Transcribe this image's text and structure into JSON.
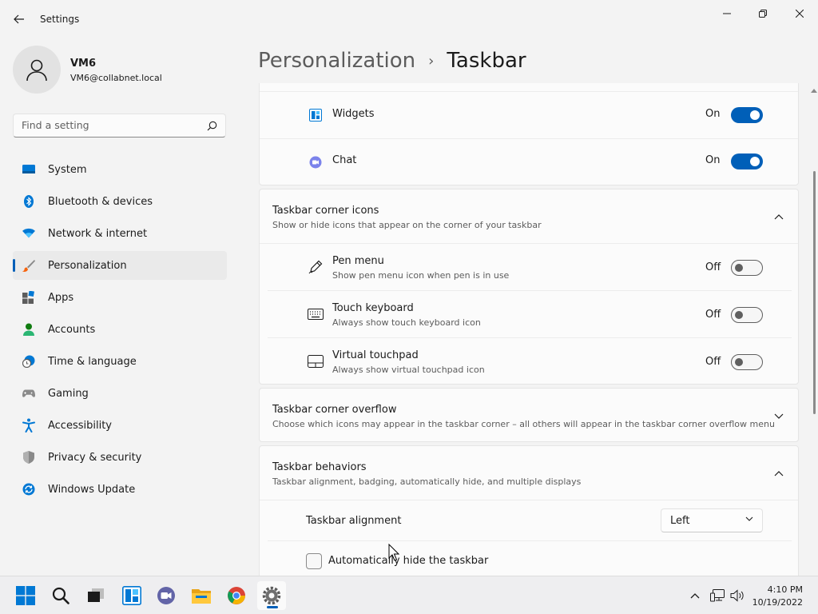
{
  "window": {
    "title": "Settings",
    "controls": [
      "minimize",
      "maximize",
      "close"
    ]
  },
  "profile": {
    "name": "VM6",
    "email": "VM6@collabnet.local"
  },
  "search": {
    "placeholder": "Find a setting"
  },
  "sidebar": {
    "items": [
      {
        "label": "System",
        "icon": "monitor-icon"
      },
      {
        "label": "Bluetooth & devices",
        "icon": "bluetooth-icon"
      },
      {
        "label": "Network & internet",
        "icon": "wifi-icon"
      },
      {
        "label": "Personalization",
        "icon": "paintbrush-icon",
        "active": true
      },
      {
        "label": "Apps",
        "icon": "apps-icon"
      },
      {
        "label": "Accounts",
        "icon": "person-icon"
      },
      {
        "label": "Time & language",
        "icon": "clock-globe-icon"
      },
      {
        "label": "Gaming",
        "icon": "gamepad-icon"
      },
      {
        "label": "Accessibility",
        "icon": "accessibility-icon"
      },
      {
        "label": "Privacy & security",
        "icon": "shield-icon"
      },
      {
        "label": "Windows Update",
        "icon": "update-icon"
      }
    ]
  },
  "breadcrumb": {
    "parent": "Personalization",
    "separator": "›",
    "current": "Taskbar"
  },
  "taskbar_items": {
    "widgets": {
      "label": "Widgets",
      "state": "On",
      "on": true
    },
    "chat": {
      "label": "Chat",
      "state": "On",
      "on": true
    }
  },
  "corner_icons": {
    "title": "Taskbar corner icons",
    "subtitle": "Show or hide icons that appear on the corner of your taskbar",
    "expanded": true,
    "items": [
      {
        "title": "Pen menu",
        "subtitle": "Show pen menu icon when pen is in use",
        "state": "Off",
        "on": false
      },
      {
        "title": "Touch keyboard",
        "subtitle": "Always show touch keyboard icon",
        "state": "Off",
        "on": false
      },
      {
        "title": "Virtual touchpad",
        "subtitle": "Always show virtual touchpad icon",
        "state": "Off",
        "on": false
      }
    ]
  },
  "corner_overflow": {
    "title": "Taskbar corner overflow",
    "subtitle": "Choose which icons may appear in the taskbar corner – all others will appear in the taskbar corner overflow menu",
    "expanded": false
  },
  "behaviors": {
    "title": "Taskbar behaviors",
    "subtitle": "Taskbar alignment, badging, automatically hide, and multiple displays",
    "expanded": true,
    "alignment_label": "Taskbar alignment",
    "alignment_value": "Left",
    "autohide_label": "Automatically hide the taskbar",
    "autohide_checked": false
  },
  "system_taskbar": {
    "time": "4:10 PM",
    "date": "10/19/2022",
    "apps": [
      "start-icon",
      "search-icon",
      "task-view-icon",
      "widgets-icon",
      "chat-icon",
      "file-explorer-icon",
      "chrome-icon",
      "settings-icon"
    ],
    "tray": [
      "chevron-up-icon",
      "network-icon",
      "volume-icon"
    ]
  },
  "colors": {
    "accent": "#005fb8",
    "background": "#f3f3f3",
    "card": "#fbfbfb"
  }
}
